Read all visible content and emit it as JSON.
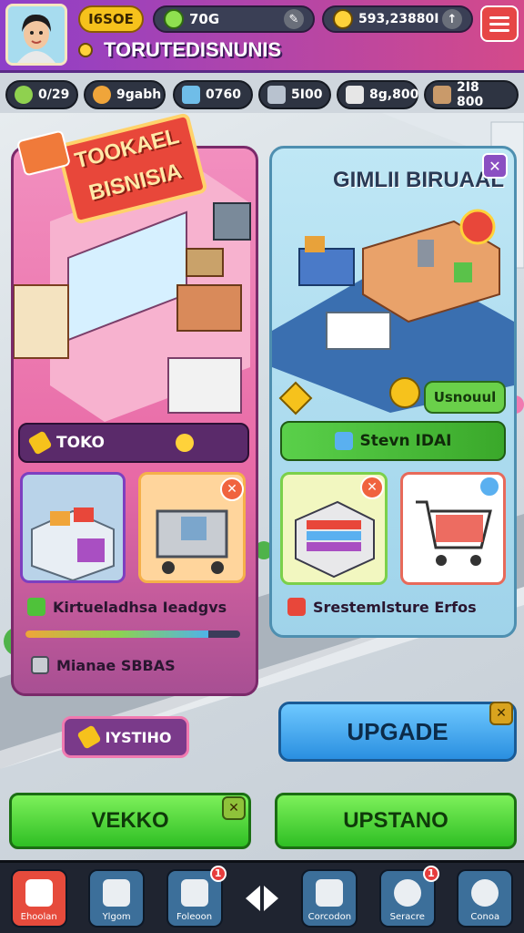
{
  "header": {
    "level": "I6SOE",
    "gems": "70G",
    "cash": "593,23880I",
    "company_name": "TORUTEDISNUNIS"
  },
  "resources": [
    {
      "icon": "leaf-icon",
      "value": "0/29"
    },
    {
      "icon": "worker-icon",
      "value": "9gabh"
    },
    {
      "icon": "box-icon",
      "value": "0760"
    },
    {
      "icon": "truck-icon",
      "value": "5I00"
    },
    {
      "icon": "chart-icon",
      "value": "8g,800"
    },
    {
      "icon": "crate-icon",
      "value": "2I8 800"
    }
  ],
  "left_panel": {
    "sign": "TOOKAEL BISNISIA",
    "tab_label": "TOKO",
    "stat_label": "Kirtueladhsa Ieadgvs",
    "progress": 0.85,
    "footer_label": "Mianae SBBAS"
  },
  "right_panel": {
    "title": "GIMLII BIRUAAL",
    "badge_button": "Usnouul",
    "bar_label": "Stevn IDAI",
    "footer_label": "Srestemlsture Erfos"
  },
  "tag_button": "IYSTIHO",
  "upgrade_button": "UPGADE",
  "bottom_buttons": {
    "left": "VEKKO",
    "right": "UPSTANO"
  },
  "nav": [
    {
      "label": "Ehoolan",
      "icon": "home-icon",
      "badge": ""
    },
    {
      "label": "Ylgom",
      "icon": "tools-icon",
      "badge": ""
    },
    {
      "label": "Foleoon",
      "icon": "clipboard-icon",
      "badge": "1"
    },
    {
      "label": "Corcodon",
      "icon": "package-icon",
      "badge": ""
    },
    {
      "label": "Seracre",
      "icon": "clock-icon",
      "badge": "1"
    },
    {
      "label": "Conoa",
      "icon": "profile-icon",
      "badge": ""
    }
  ]
}
